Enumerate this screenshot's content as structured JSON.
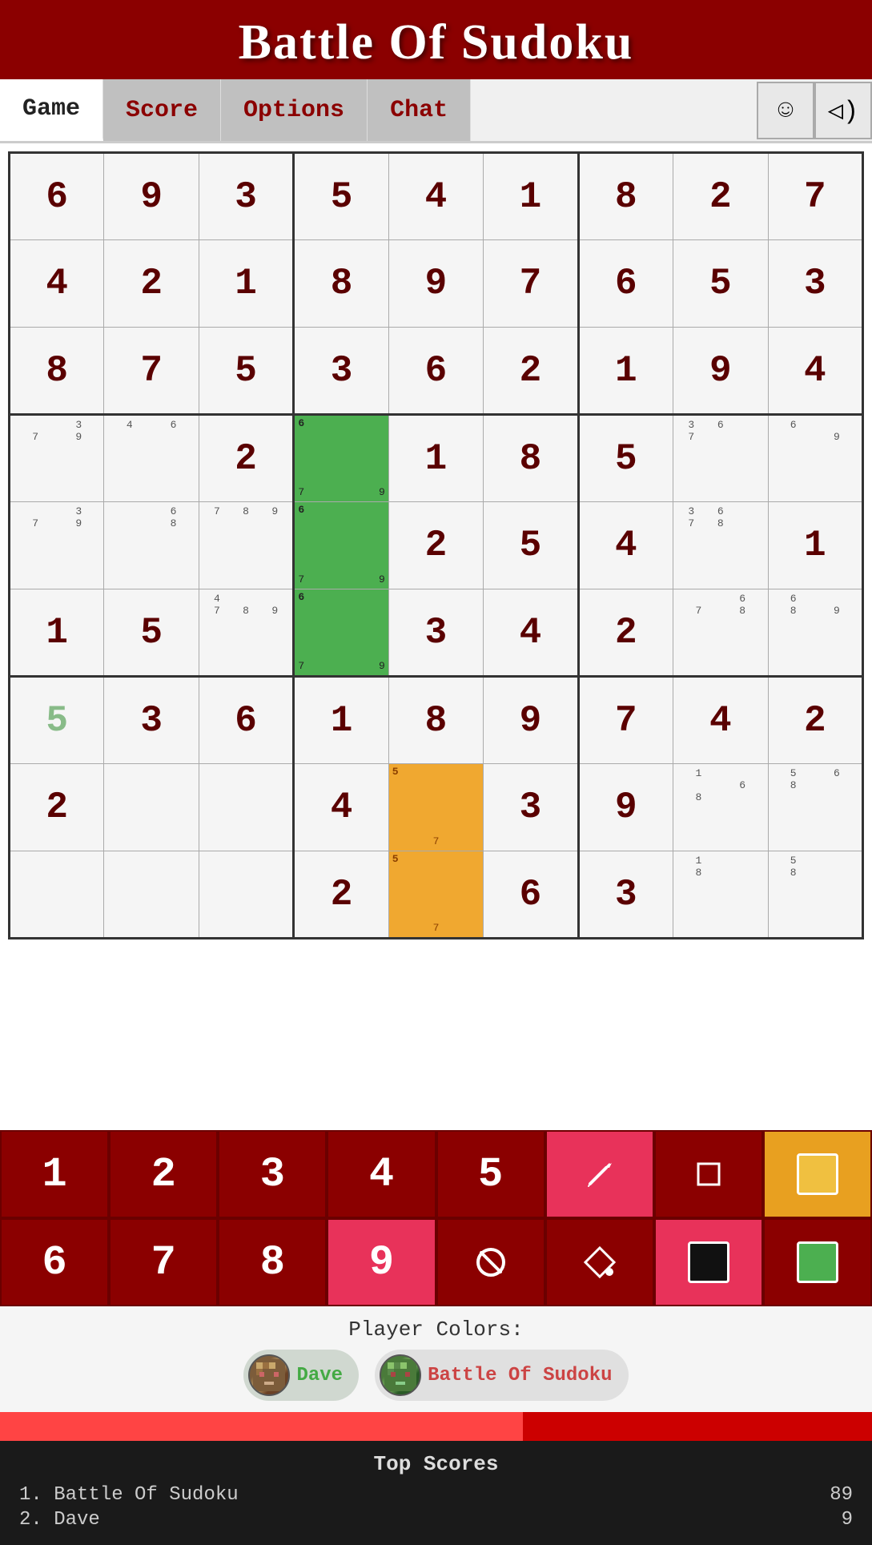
{
  "header": {
    "title": "Battle Of Sudoku"
  },
  "nav": {
    "tabs": [
      {
        "id": "game",
        "label": "Game",
        "active": true
      },
      {
        "id": "score",
        "label": "Score",
        "active": false
      },
      {
        "id": "options",
        "label": "Options",
        "active": false
      },
      {
        "id": "chat",
        "label": "Chat",
        "active": false
      }
    ],
    "smiley_icon": "☺",
    "speaker_icon": "◁)"
  },
  "grid": {
    "rows": [
      [
        {
          "val": "6",
          "type": "given"
        },
        {
          "val": "9",
          "type": "given"
        },
        {
          "val": "3",
          "type": "player1"
        },
        {
          "val": "5",
          "type": "given"
        },
        {
          "val": "4",
          "type": "given"
        },
        {
          "val": "1",
          "type": "given"
        },
        {
          "val": "8",
          "type": "player1"
        },
        {
          "val": "2",
          "type": "given"
        },
        {
          "val": "7",
          "type": "given"
        }
      ],
      [
        {
          "val": "4",
          "type": "player1"
        },
        {
          "val": "2",
          "type": "given"
        },
        {
          "val": "1",
          "type": "player1"
        },
        {
          "val": "8",
          "type": "given"
        },
        {
          "val": "9",
          "type": "player1"
        },
        {
          "val": "7",
          "type": "given"
        },
        {
          "val": "6",
          "type": "player1"
        },
        {
          "val": "5",
          "type": "given"
        },
        {
          "val": "3",
          "type": "given"
        }
      ],
      [
        {
          "val": "8",
          "type": "given"
        },
        {
          "val": "7",
          "type": "given"
        },
        {
          "val": "5",
          "type": "given"
        },
        {
          "val": "3",
          "type": "given"
        },
        {
          "val": "6",
          "type": "given"
        },
        {
          "val": "2",
          "type": "given"
        },
        {
          "val": "1",
          "type": "player1"
        },
        {
          "val": "9",
          "type": "given"
        },
        {
          "val": "4",
          "type": "given"
        }
      ],
      [
        {
          "val": "",
          "type": "notes",
          "notes": "3\n7  9"
        },
        {
          "val": "",
          "type": "notes",
          "notes": "4  6"
        },
        {
          "val": "2",
          "type": "player1"
        },
        {
          "val": "",
          "type": "green",
          "notes": "6\n7  9"
        },
        {
          "val": "1",
          "type": "given"
        },
        {
          "val": "8",
          "type": "given"
        },
        {
          "val": "5",
          "type": "given"
        },
        {
          "val": "",
          "type": "notes",
          "notes": "3 6\n7"
        },
        {
          "val": "",
          "type": "notes",
          "notes": "6\n  9"
        }
      ],
      [
        {
          "val": "",
          "type": "notes",
          "notes": "3\n7  9"
        },
        {
          "val": "",
          "type": "notes",
          "notes": "  6\n  8"
        },
        {
          "val": "",
          "type": "notes",
          "notes": "7 8 9"
        },
        {
          "val": "",
          "type": "green",
          "notes": "6\n7  9"
        },
        {
          "val": "2",
          "type": "given"
        },
        {
          "val": "5",
          "type": "given"
        },
        {
          "val": "4",
          "type": "given"
        },
        {
          "val": "",
          "type": "notes",
          "notes": "3 6\n7 8"
        },
        {
          "val": "1",
          "type": "given"
        }
      ],
      [
        {
          "val": "1",
          "type": "player1"
        },
        {
          "val": "5",
          "type": "given"
        },
        {
          "val": "",
          "type": "notes",
          "notes": "4\n7 8 9"
        },
        {
          "val": "",
          "type": "green",
          "notes": "6\n7  9"
        },
        {
          "val": "3",
          "type": "player1"
        },
        {
          "val": "4",
          "type": "given"
        },
        {
          "val": "2",
          "type": "given"
        },
        {
          "val": "",
          "type": "notes",
          "notes": "  6\n7 8"
        },
        {
          "val": "",
          "type": "notes",
          "notes": "6\n8  9"
        }
      ],
      [
        {
          "val": "5",
          "type": "player-light"
        },
        {
          "val": "3",
          "type": "given"
        },
        {
          "val": "6",
          "type": "given"
        },
        {
          "val": "1",
          "type": "given"
        },
        {
          "val": "8",
          "type": "given"
        },
        {
          "val": "9",
          "type": "given"
        },
        {
          "val": "7",
          "type": "given"
        },
        {
          "val": "4",
          "type": "given"
        },
        {
          "val": "2",
          "type": "player1"
        }
      ],
      [
        {
          "val": "2",
          "type": "given"
        },
        {
          "val": "",
          "type": "empty"
        },
        {
          "val": "",
          "type": "empty"
        },
        {
          "val": "4",
          "type": "given"
        },
        {
          "val": "",
          "type": "orange",
          "notes": "5\n7"
        },
        {
          "val": "3",
          "type": "given"
        },
        {
          "val": "9",
          "type": "given"
        },
        {
          "val": "",
          "type": "notes",
          "notes": "1\n  6\n8"
        },
        {
          "val": "",
          "type": "notes",
          "notes": "5 6\n8"
        }
      ],
      [
        {
          "val": "",
          "type": "empty"
        },
        {
          "val": "",
          "type": "empty"
        },
        {
          "val": "",
          "type": "empty"
        },
        {
          "val": "2",
          "type": "given"
        },
        {
          "val": "",
          "type": "orange",
          "notes": "5\n7"
        },
        {
          "val": "6",
          "type": "given"
        },
        {
          "val": "3",
          "type": "given"
        },
        {
          "val": "",
          "type": "notes",
          "notes": "1\n\n8"
        },
        {
          "val": "",
          "type": "notes",
          "notes": "5\n8"
        }
      ]
    ]
  },
  "numpad": {
    "row1": [
      {
        "label": "1",
        "id": "n1",
        "highlight": false
      },
      {
        "label": "2",
        "id": "n2",
        "highlight": false
      },
      {
        "label": "3",
        "id": "n3",
        "highlight": false
      },
      {
        "label": "4",
        "id": "n4",
        "highlight": false
      },
      {
        "label": "5",
        "id": "n5",
        "highlight": false
      },
      {
        "label": "✏",
        "id": "pencil",
        "highlight": true,
        "tool": true
      },
      {
        "label": "□",
        "id": "square",
        "tool": true
      },
      {
        "label": "",
        "id": "orange-color",
        "color": "orange"
      }
    ],
    "row2": [
      {
        "label": "6",
        "id": "n6",
        "highlight": false
      },
      {
        "label": "7",
        "id": "n7",
        "highlight": false
      },
      {
        "label": "8",
        "id": "n8",
        "highlight": false
      },
      {
        "label": "9",
        "id": "n9",
        "highlight": true
      },
      {
        "label": "⊘",
        "id": "ban",
        "tool": true
      },
      {
        "label": "◇",
        "id": "diamond",
        "tool": true
      },
      {
        "label": "",
        "id": "black-color",
        "color": "black-sq"
      },
      {
        "label": "",
        "id": "green-color",
        "color": "green-sq"
      }
    ]
  },
  "player_colors": {
    "label": "Player Colors:",
    "players": [
      {
        "name": "Dave",
        "color": "green",
        "avatar": "🎮"
      },
      {
        "name": "Battle Of Sudoku",
        "color": "red",
        "avatar": "🎮"
      }
    ]
  },
  "top_scores": {
    "title": "Top Scores",
    "entries": [
      {
        "rank": "1.",
        "name": "Battle Of Sudoku",
        "score": "89"
      },
      {
        "rank": "2.",
        "name": "Dave",
        "score": "9"
      }
    ]
  }
}
